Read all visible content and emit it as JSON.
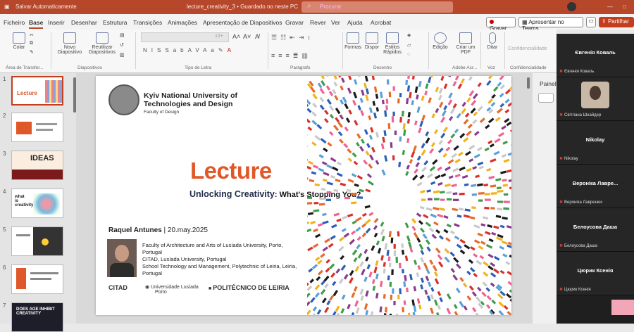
{
  "titlebar": {
    "autosave": "Salvar Automaticamente",
    "filename": "lecture_creativity_3 • Guardado no neste PC",
    "search_placeholder": "Procurar"
  },
  "menu": {
    "items": [
      "Ficheiro",
      "Base",
      "Inserir",
      "Desenhar",
      "Estrutura",
      "Transições",
      "Animações",
      "Apresentação de Diapositivos",
      "Gravar",
      "Rever",
      "Ver",
      "Ajuda",
      "Acrobat"
    ],
    "active": "Base",
    "record_label": "Gravar",
    "teams_label": "Apresentar no Teams",
    "share_label": "Partilhar"
  },
  "ribbon": {
    "paste": "Colar",
    "clipboard_group": "Área de Transfer...",
    "new_slide": "Novo Diapositivo",
    "reuse": "Reutilizar Diapositivos",
    "slides_group": "Diapositivos",
    "font_group": "Tipo de Letra",
    "font_size": "12+",
    "paragraph_group": "Parágrafo",
    "shapes": "Formas",
    "arrange": "Dispor",
    "quick_styles": "Estilos Rápidos",
    "drawing_group": "Desenho",
    "editing": "Edição",
    "create_pdf": "Criar um PDF",
    "acrobat_group": "Adobe Acr...",
    "dictate": "Ditar",
    "voice_group": "Voz",
    "sensitivity": "Confidencialidade",
    "sensitivity_group": "Confidencialidade"
  },
  "slide": {
    "university": "Kyiv National University of Technologies and Design",
    "faculty": "Faculty of Design",
    "title": "Lecture",
    "subtitle_main": "Unlocking Creativity",
    "subtitle_rest": ": What's Stopping You?",
    "author_name": "Raquel Antunes",
    "author_date": " | 20.may.2025",
    "affiliations": [
      "Faculty of Architecture and Arts of Lusíada University, Porto, Portugal",
      "CITAD, Lusíada University, Portugal",
      "School Technology and Management, Polytechnic of Leiria, Leiria, Portugal"
    ],
    "logo_citad": "CITAD",
    "logo_lusiada": "Universidade Lusíada",
    "logo_lusiada_sub": "Porto",
    "logo_poly": "POLITÉCNICO DE LEIRIA"
  },
  "thumbnails": [
    {
      "num": "1",
      "label": "Lecture"
    },
    {
      "num": "2",
      "label": ""
    },
    {
      "num": "3",
      "label": "IDEAS"
    },
    {
      "num": "4",
      "label": "what is creativity?"
    },
    {
      "num": "5",
      "label": ""
    },
    {
      "num": "6",
      "label": ""
    },
    {
      "num": "7",
      "label": "DOES AGE INHIBIT CREATIVITY"
    }
  ],
  "right_pane": {
    "title": "Painel"
  },
  "participants": [
    {
      "name": "Євгенія Коваль",
      "label": "Євгенія Коваль",
      "photo": false
    },
    {
      "name": "",
      "label": "Світлана Шнайдер",
      "photo": true
    },
    {
      "name": "Nikolay",
      "label": "Nikolay",
      "photo": false
    },
    {
      "name": "Вероніка Лаврe...",
      "label": "Вероніка Лавренюк",
      "photo": false
    },
    {
      "name": "Белоусова Даша",
      "label": "Белоусова Даша",
      "photo": false
    },
    {
      "name": "Цюрик Ксенія",
      "label": "Цюрик Ксенія",
      "photo": false
    }
  ],
  "colors": {
    "accent": "#b7472a",
    "title_orange": "#e0582a",
    "subtitle_navy": "#1f2d4a"
  }
}
